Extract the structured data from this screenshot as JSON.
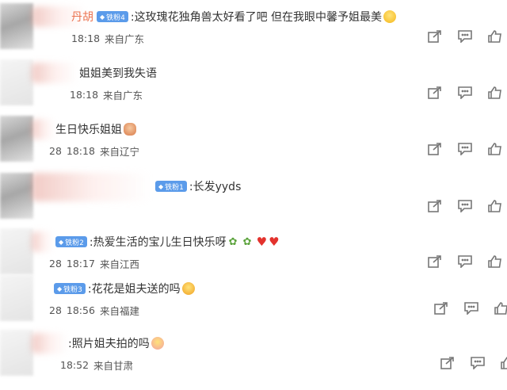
{
  "comments": [
    {
      "username": "丹胡",
      "badge": "铁粉4",
      "text": ":这玫瑰花独角兽太好看了吧 但在我眼中馨予姐最美",
      "emoji": "laugh",
      "date_prefix": "",
      "time": "18:18",
      "source": "来自广东"
    },
    {
      "username": "",
      "badge": "",
      "text": "姐姐美到我失语",
      "emoji": "",
      "date_prefix": "",
      "time": "18:18",
      "source": "来自广东"
    },
    {
      "username": "",
      "badge": "",
      "text": "生日快乐姐姐",
      "emoji": "cake",
      "date_prefix": "28",
      "time": "18:18",
      "source": "来自辽宁"
    },
    {
      "username": "",
      "badge": "铁粉1",
      "text": ":长发yyds",
      "emoji": "",
      "date_prefix": "",
      "time": "",
      "source": ""
    },
    {
      "username": "",
      "badge": "铁粉2",
      "text": ":热爱生活的宝儿生日快乐呀",
      "emoji": "leaves-hearts",
      "date_prefix": "28",
      "time": "18:17",
      "source": "来自江西"
    },
    {
      "username": "",
      "badge": "铁粉3",
      "text": ":花花是姐夫送的吗",
      "emoji": "cry",
      "date_prefix": "28",
      "time": "18:56",
      "source": "来自福建"
    },
    {
      "username": "",
      "badge": "",
      "text": ":照片姐夫拍的吗",
      "emoji": "shy",
      "date_prefix": "",
      "time": "18:52",
      "source": "来自甘肃"
    }
  ],
  "actions": {
    "icons": [
      "share-icon",
      "comment-icon",
      "like-icon"
    ]
  },
  "colors": {
    "username": "#eb7350",
    "badge": "#5b9bea",
    "heart": "#e3322d"
  }
}
